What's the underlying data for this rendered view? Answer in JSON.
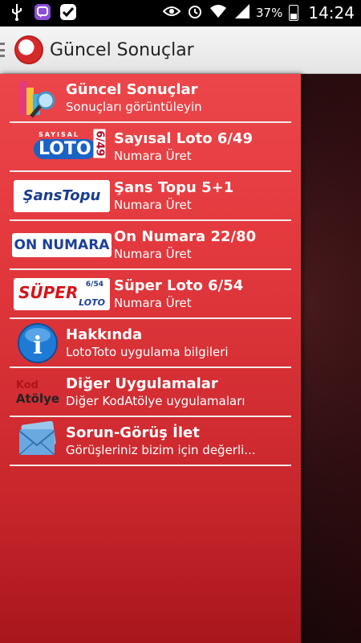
{
  "status_bar": {
    "battery": "37%",
    "time": "14:24"
  },
  "action_bar": {
    "title": "Güncel Sonuçlar"
  },
  "menu": [
    {
      "title": "Güncel Sonuçlar",
      "subtitle": "Sonuçları görüntüleyin",
      "icon": "chart-magnifier-icon"
    },
    {
      "title": "Sayısal Loto 6/49",
      "subtitle": "Numara Üret",
      "icon": "sayisal-loto-logo"
    },
    {
      "title": "Şans Topu 5+1",
      "subtitle": "Numara Üret",
      "icon": "sans-topu-logo"
    },
    {
      "title": "On Numara 22/80",
      "subtitle": "Numara Üret",
      "icon": "on-numara-logo"
    },
    {
      "title": "Süper Loto 6/54",
      "subtitle": "Numara Üret",
      "icon": "super-loto-logo"
    },
    {
      "title": "Hakkında",
      "subtitle": "LotoToto uygulama bilgileri",
      "icon": "info-icon"
    },
    {
      "title": "Diğer Uygulamalar",
      "subtitle": "Diğer KodAtölye uygulamaları",
      "icon": "kodatolye-logo"
    },
    {
      "title": "Sorun-Görüş İlet",
      "subtitle": "Görüşleriniz bizim için değerli...",
      "icon": "envelope-icon"
    }
  ],
  "logos": {
    "sayisal_small": "SAYISAL",
    "sayisal_big": "LOTO",
    "sayisal_num": "6/49",
    "sans_topu": "ŞansTopu",
    "on_numara": "ON NUMARA",
    "super": "SÜPER",
    "super_num": "6/54",
    "super_loto": "LOTO",
    "kod": "Kod",
    "atolye": "Atölye",
    "info_letter": "i"
  },
  "colors": {
    "drawer_red": "#e3393e",
    "action_bar": "#eeeeee"
  }
}
